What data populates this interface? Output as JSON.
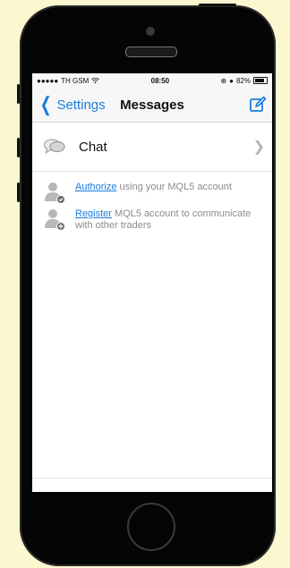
{
  "status_bar": {
    "carrier": "TH GSM",
    "time": "08:50",
    "battery": "82%"
  },
  "nav": {
    "back_label": "Settings",
    "title": "Messages"
  },
  "chat_row": {
    "label": "Chat"
  },
  "authorize": {
    "link": "Authorize",
    "text": " using your MQL5 account"
  },
  "register": {
    "link": "Register",
    "text": " MQL5 account to communicate with other traders"
  },
  "colors": {
    "accent": "#1a7de0",
    "background": "#fbf7cf"
  },
  "icons": {
    "back": "chevron-left-icon",
    "compose": "compose-icon",
    "chat": "chat-bubbles-icon",
    "authorize": "user-check-icon",
    "register": "user-add-icon"
  }
}
